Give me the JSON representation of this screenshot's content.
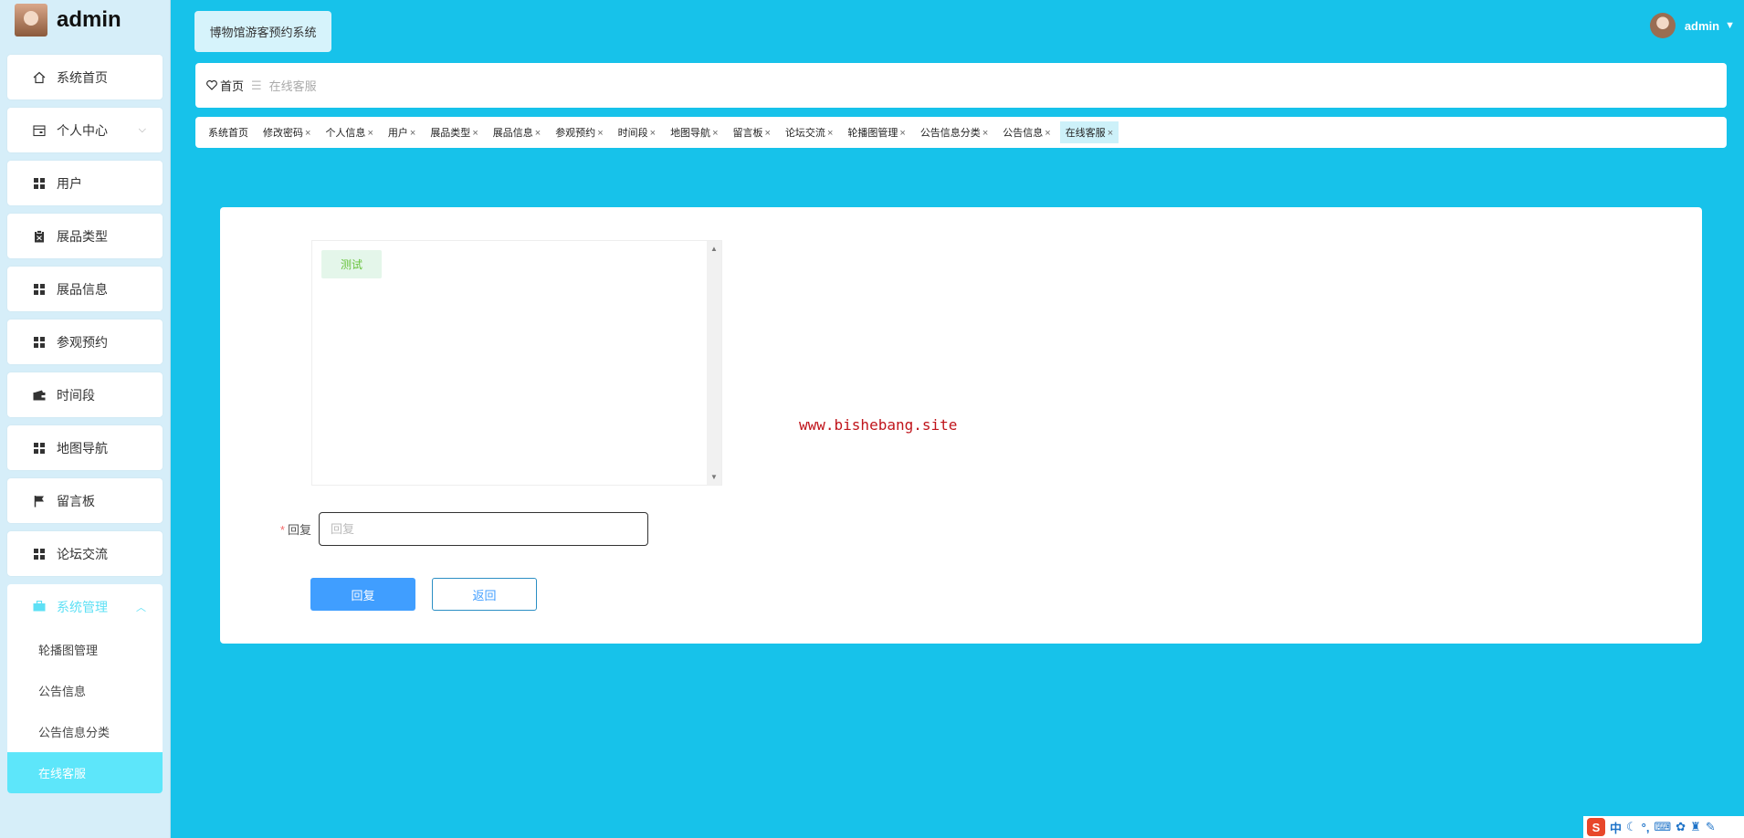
{
  "brand": {
    "name": "admin"
  },
  "header": {
    "system_title": "博物馆游客预约系统",
    "user_name": "admin"
  },
  "sidebar": {
    "items": [
      {
        "label": "系统首页",
        "icon": "home-icon"
      },
      {
        "label": "个人中心",
        "icon": "calendar-icon",
        "has_children": true
      },
      {
        "label": "用户",
        "icon": "grid-icon"
      },
      {
        "label": "展品类型",
        "icon": "clipboard-icon"
      },
      {
        "label": "展品信息",
        "icon": "grid-icon"
      },
      {
        "label": "参观预约",
        "icon": "grid-icon"
      },
      {
        "label": "时间段",
        "icon": "wallet-icon"
      },
      {
        "label": "地图导航",
        "icon": "grid-icon"
      },
      {
        "label": "留言板",
        "icon": "flag-icon"
      },
      {
        "label": "论坛交流",
        "icon": "grid-icon"
      }
    ],
    "group": {
      "label": "系统管理",
      "icon": "briefcase-icon",
      "children": [
        "轮播图管理",
        "公告信息",
        "公告信息分类",
        "在线客服"
      ],
      "active_child": "在线客服"
    }
  },
  "breadcrumb": {
    "home": "首页",
    "current": "在线客服"
  },
  "tabs": [
    {
      "label": "系统首页",
      "closable": false
    },
    {
      "label": "修改密码",
      "closable": true
    },
    {
      "label": "个人信息",
      "closable": true
    },
    {
      "label": "用户",
      "closable": true
    },
    {
      "label": "展品类型",
      "closable": true
    },
    {
      "label": "展品信息",
      "closable": true
    },
    {
      "label": "参观预约",
      "closable": true
    },
    {
      "label": "时间段",
      "closable": true
    },
    {
      "label": "地图导航",
      "closable": true
    },
    {
      "label": "留言板",
      "closable": true
    },
    {
      "label": "论坛交流",
      "closable": true
    },
    {
      "label": "轮播图管理",
      "closable": true
    },
    {
      "label": "公告信息分类",
      "closable": true
    },
    {
      "label": "公告信息",
      "closable": true
    },
    {
      "label": "在线客服",
      "closable": true,
      "active": true
    }
  ],
  "chat": {
    "messages": [
      {
        "text": "测试"
      }
    ],
    "watermark": "www.bishebang.site"
  },
  "form": {
    "reply_label": "回复",
    "required_mark": "*",
    "reply_placeholder": "回复",
    "reply_value": "",
    "submit_label": "回复",
    "back_label": "返回"
  },
  "ime": {
    "logo": "S",
    "mode": "中"
  },
  "colors": {
    "background": "#17c2ea",
    "sidebar_bg": "#d6eef9",
    "active_item": "#5de6fa",
    "primary": "#409eff",
    "watermark": "#c0141b",
    "message_bg": "#e4f6ea",
    "message_text": "#67c23a"
  }
}
